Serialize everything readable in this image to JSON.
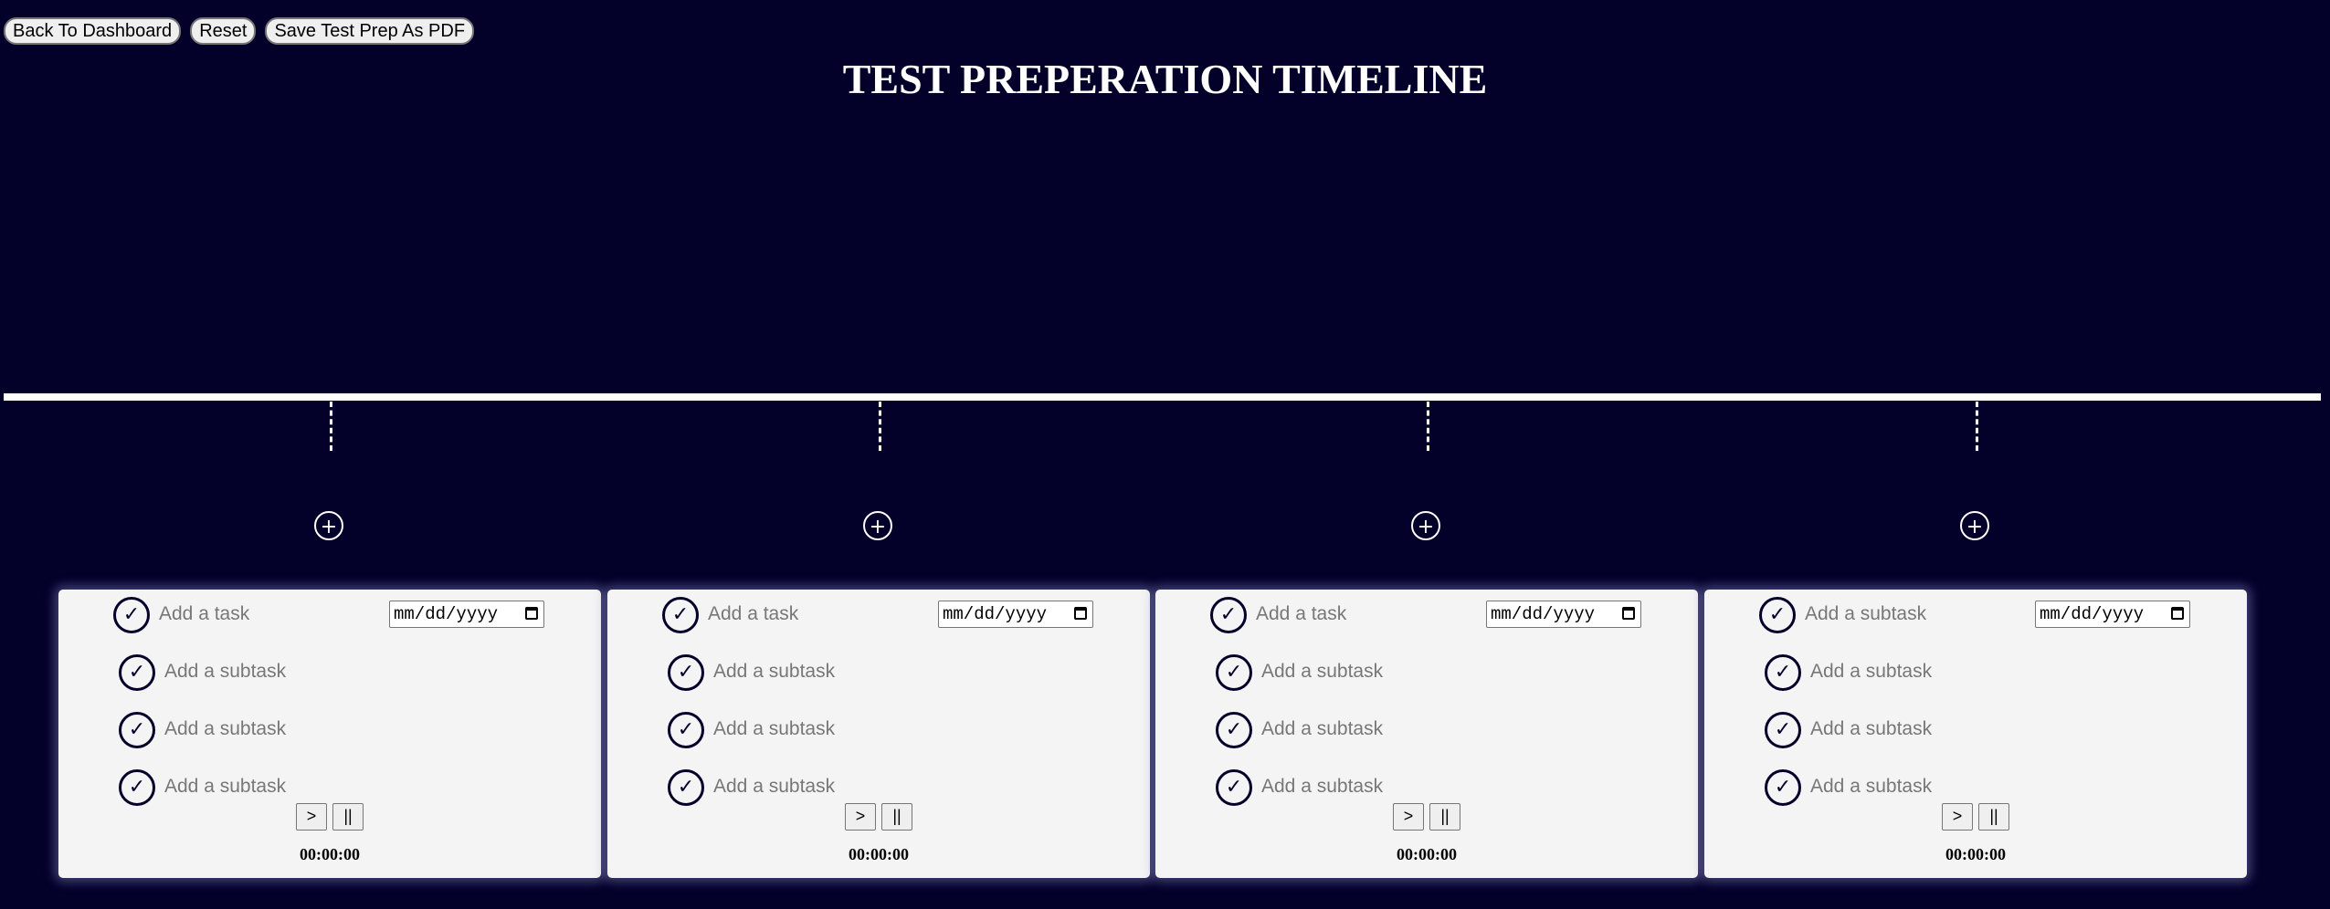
{
  "toolbar": {
    "back_label": "Back To Dashboard",
    "reset_label": "Reset",
    "save_label": "Save Test Prep As PDF"
  },
  "page": {
    "title": "TEST PREPERATION TIMELINE"
  },
  "timeline": {
    "add_symbol": "+"
  },
  "cards": [
    {
      "task_placeholder": "Add a task",
      "date_placeholder": "mm/dd/yyyy",
      "subtasks": [
        "Add a subtask",
        "Add a subtask",
        "Add a subtask"
      ],
      "play_label": ">",
      "pause_label": "||",
      "timer": "00:00:00"
    },
    {
      "task_placeholder": "Add a task",
      "date_placeholder": "mm/dd/yyyy",
      "subtasks": [
        "Add a subtask",
        "Add a subtask",
        "Add a subtask"
      ],
      "play_label": ">",
      "pause_label": "||",
      "timer": "00:00:00"
    },
    {
      "task_placeholder": "Add a task",
      "date_placeholder": "mm/dd/yyyy",
      "subtasks": [
        "Add a subtask",
        "Add a subtask",
        "Add a subtask"
      ],
      "play_label": ">",
      "pause_label": "||",
      "timer": "00:00:00"
    },
    {
      "task_placeholder": "Add a subtask",
      "date_placeholder": "mm/dd/yyyy",
      "subtasks": [
        "Add a subtask",
        "Add a subtask",
        "Add a subtask"
      ],
      "play_label": ">",
      "pause_label": "||",
      "timer": "00:00:00"
    }
  ],
  "check_symbol": "✓",
  "colors": {
    "background": "#03012a",
    "card": "#f4f4f4",
    "timeline": "#ffffff"
  }
}
